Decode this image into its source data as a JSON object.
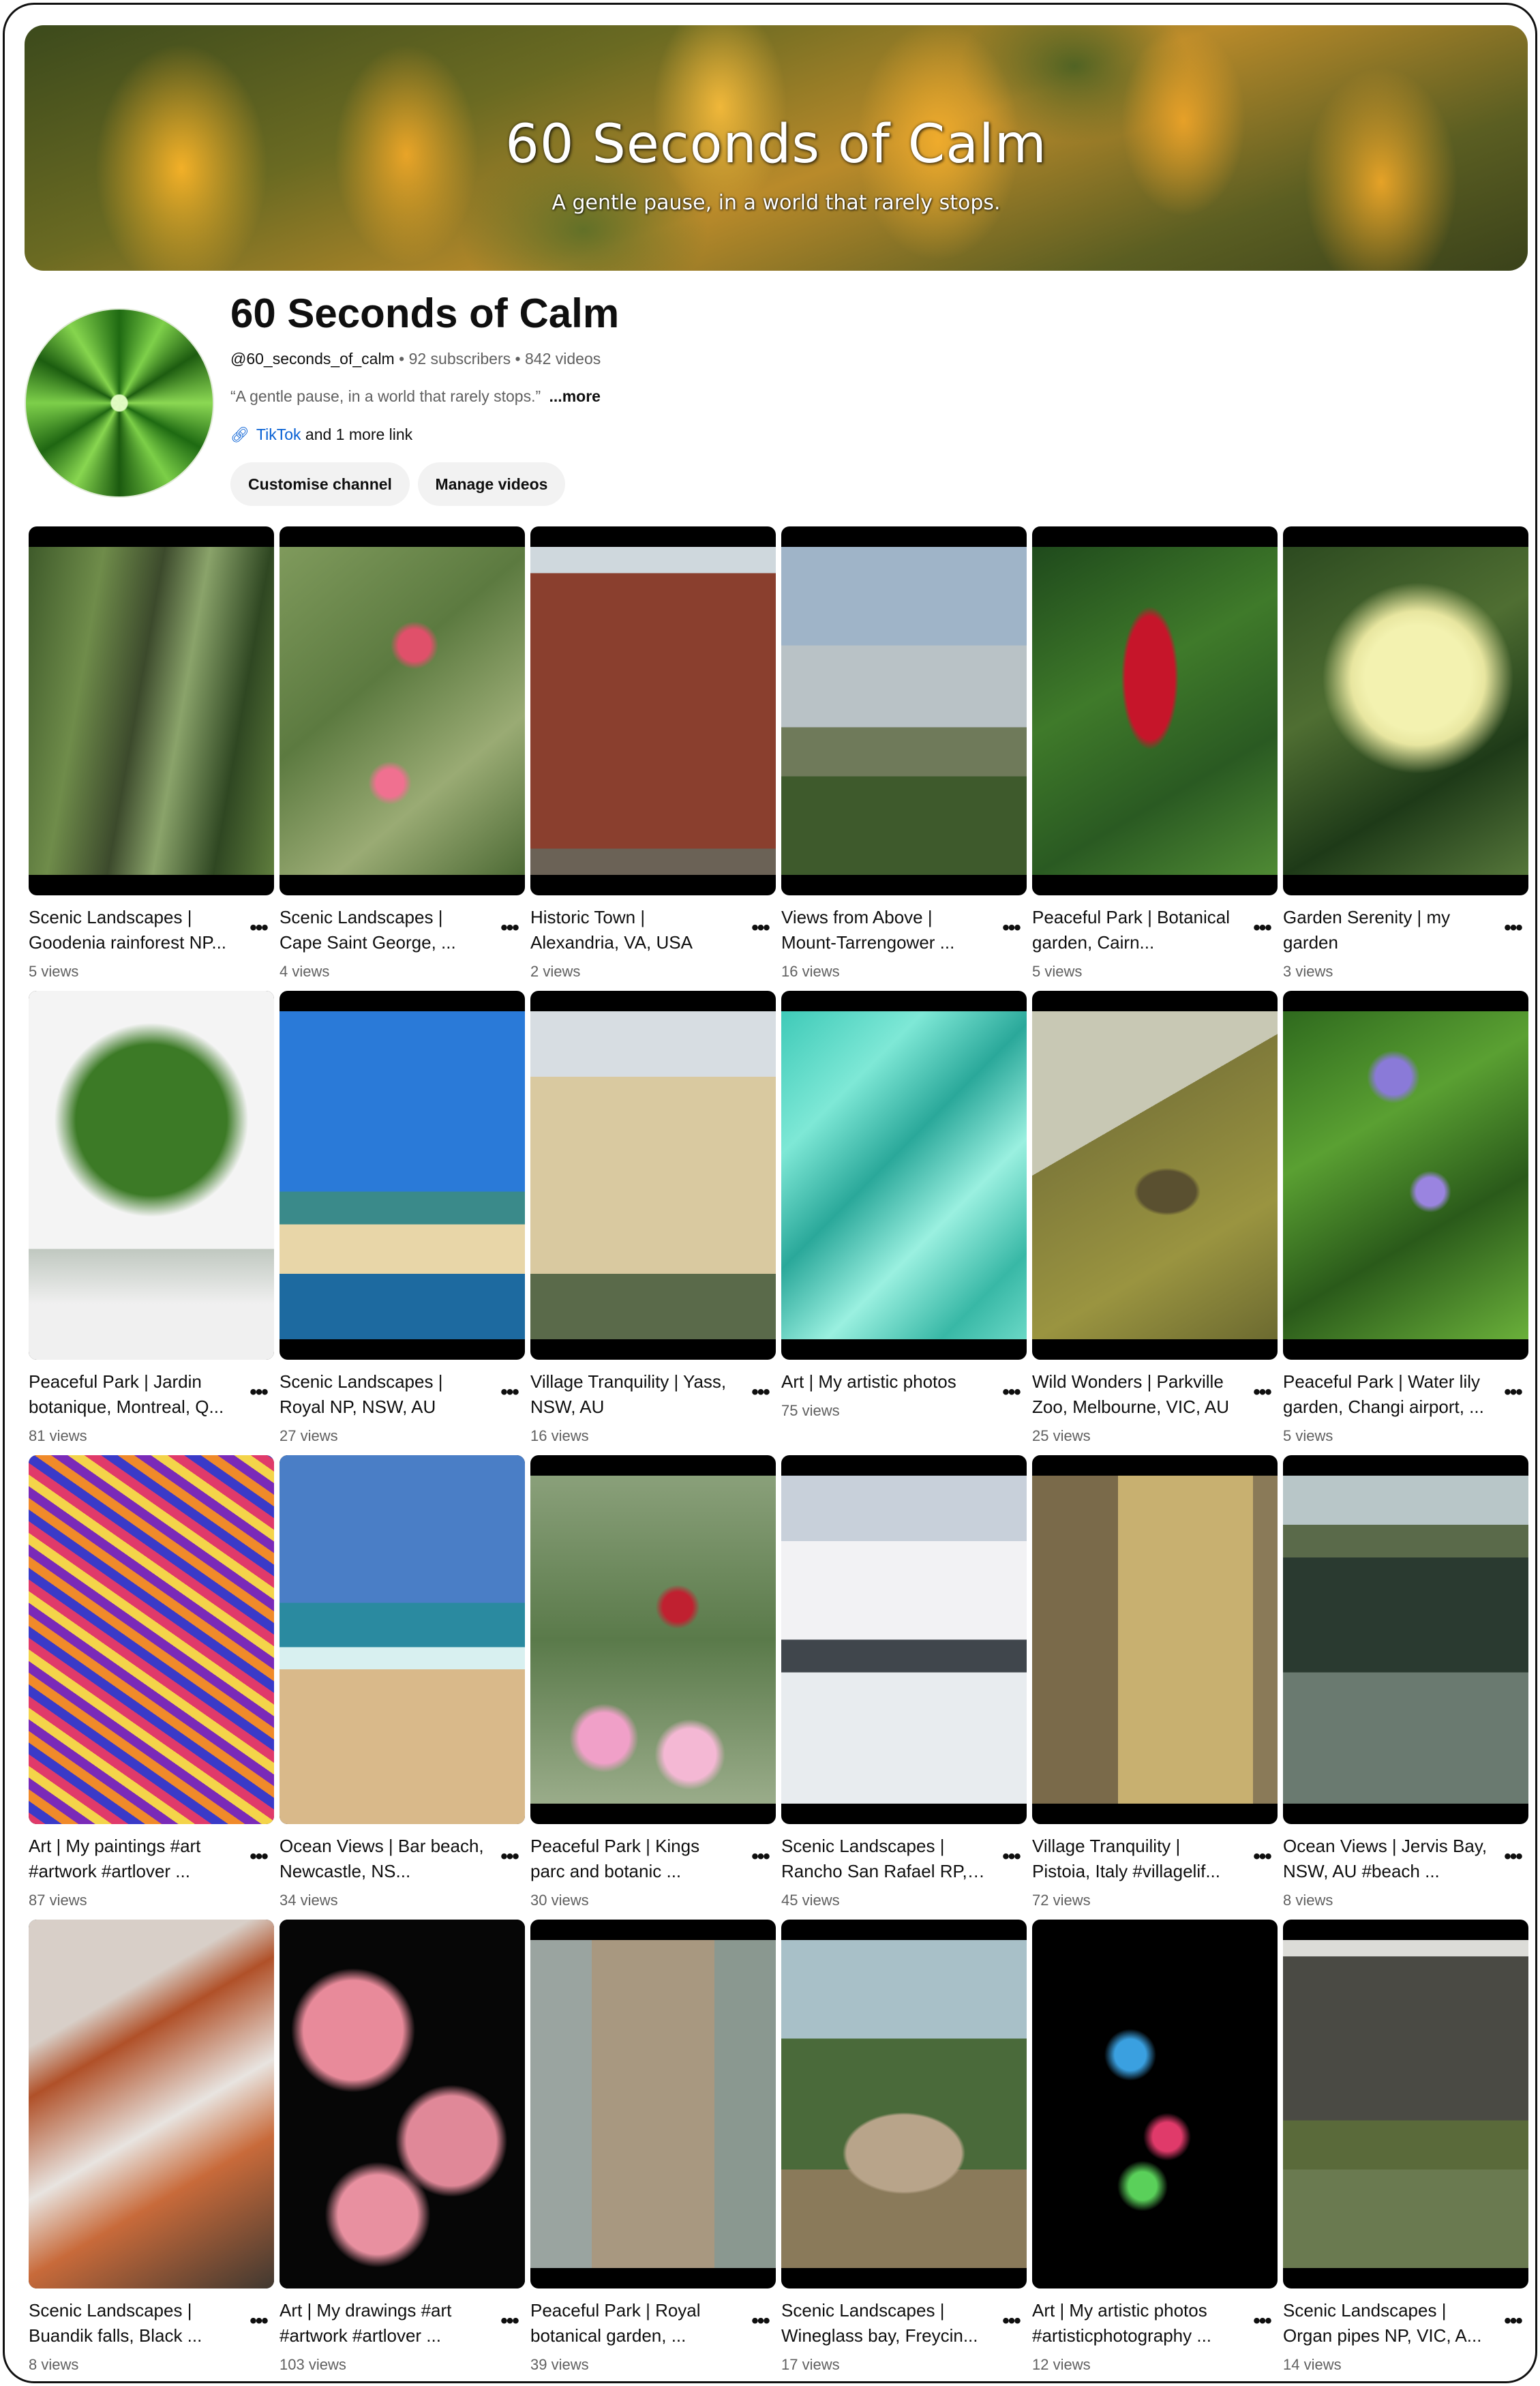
{
  "banner": {
    "title": "60 Seconds of Calm",
    "subtitle": "A gentle pause, in a world that rarely stops."
  },
  "channel": {
    "name": "60 Seconds of Calm",
    "handle": "@60_seconds_of_calm",
    "subscribers": "92 subscribers",
    "videos": "842 videos",
    "description": "“A gentle pause, in a world that rarely stops.”",
    "more_label": "...more",
    "link_name": "TikTok",
    "more_links": "and 1 more link",
    "customise_label": "Customise channel",
    "manage_label": "Manage videos"
  },
  "videos": [
    {
      "title": "Scenic Landscapes | Goodenia rainforest NP...",
      "views": "5 views"
    },
    {
      "title": "Scenic Landscapes | Cape Saint George, ...",
      "views": "4 views"
    },
    {
      "title": "Historic Town | Alexandria, VA, USA",
      "views": "2 views"
    },
    {
      "title": "Views from Above | Mount-Tarrengower ...",
      "views": "16 views"
    },
    {
      "title": "Peaceful Park | Botanical garden, Cairn...",
      "views": "5 views"
    },
    {
      "title": "Garden Serenity | my garden",
      "views": "3 views"
    },
    {
      "title": "Peaceful Park | Jardin botanique, Montreal, Q...",
      "views": "81 views"
    },
    {
      "title": "Scenic Landscapes | Royal NP, NSW, AU",
      "views": "27 views"
    },
    {
      "title": "Village Tranquility | Yass, NSW, AU",
      "views": "16 views"
    },
    {
      "title": "Art | My artistic photos",
      "views": "75 views"
    },
    {
      "title": "Wild Wonders | Parkville Zoo, Melbourne, VIC, AU",
      "views": "25 views"
    },
    {
      "title": "Peaceful Park | Water lily garden, Changi airport, ...",
      "views": "5 views"
    },
    {
      "title": "Art | My paintings #art #artwork #artlover ...",
      "views": "87 views"
    },
    {
      "title": "Ocean Views | Bar beach, Newcastle, NS...",
      "views": "34 views"
    },
    {
      "title": "Peaceful Park | Kings parc and botanic ...",
      "views": "30 views"
    },
    {
      "title": "Scenic Landscapes | Rancho San Rafael RP, ...",
      "views": "45 views"
    },
    {
      "title": "Village Tranquility | Pistoia, Italy #villagelif...",
      "views": "72 views"
    },
    {
      "title": "Ocean Views | Jervis Bay, NSW, AU #beach ...",
      "views": "8 views"
    },
    {
      "title": "Scenic Landscapes | Buandik falls, Black ...",
      "views": "8 views"
    },
    {
      "title": "Art | My drawings #art #artwork #artlover ...",
      "views": "103 views"
    },
    {
      "title": "Peaceful Park | Royal botanical garden, ...",
      "views": "39 views"
    },
    {
      "title": "Scenic Landscapes | Wineglass bay, Freycin...",
      "views": "17 views"
    },
    {
      "title": "Art | My artistic photos #artisticphotography ...",
      "views": "12 views"
    },
    {
      "title": "Scenic Landscapes | Organ pipes NP, VIC, A...",
      "views": "14 views"
    }
  ],
  "icons": {
    "link": "link-icon",
    "menu": "more-vert-icon"
  },
  "colors": {
    "link": "#065fd4",
    "secondary_text": "#606060",
    "button_bg": "#f2f2f2"
  }
}
